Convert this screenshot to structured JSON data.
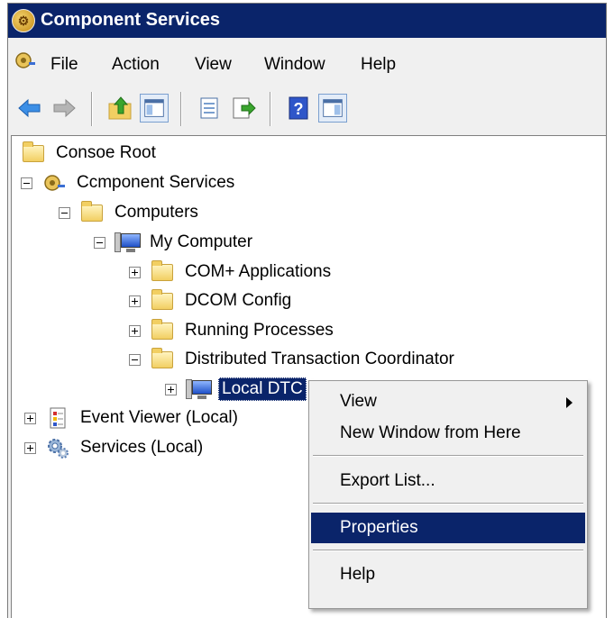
{
  "window": {
    "title": "Component Services"
  },
  "menu": {
    "items": [
      "File",
      "Action",
      "View",
      "Window",
      "Help"
    ]
  },
  "toolbar": {
    "buttons": [
      "back-icon",
      "forward-icon",
      "up-one-level-icon",
      "show-hide-console-tree-icon",
      "properties-icon",
      "export-list-icon",
      "help-icon",
      "show-hide-action-pane-icon"
    ]
  },
  "tree": {
    "root": "Consoe Root",
    "component_services": "Ccmponent Services",
    "computers": "Computers",
    "my_computer": "My Computer",
    "com_apps": "COM+ Applications",
    "dcom_config": "DCOM Config",
    "running_processes": "Running Processes",
    "dtc": "Distributed Transaction Coordinator",
    "local_dtc": "Local DTC",
    "event_viewer": "Event Viewer (Local)",
    "services": "Services (Local)"
  },
  "context_menu": {
    "view": "View",
    "new_window": "New Window from Here",
    "export_list": "Export List...",
    "properties": "Properties",
    "help": "Help",
    "highlighted": "Properties"
  },
  "colors": {
    "titlebar": "#0a246a",
    "selection": "#0a246a",
    "chrome": "#f0f0f0"
  }
}
